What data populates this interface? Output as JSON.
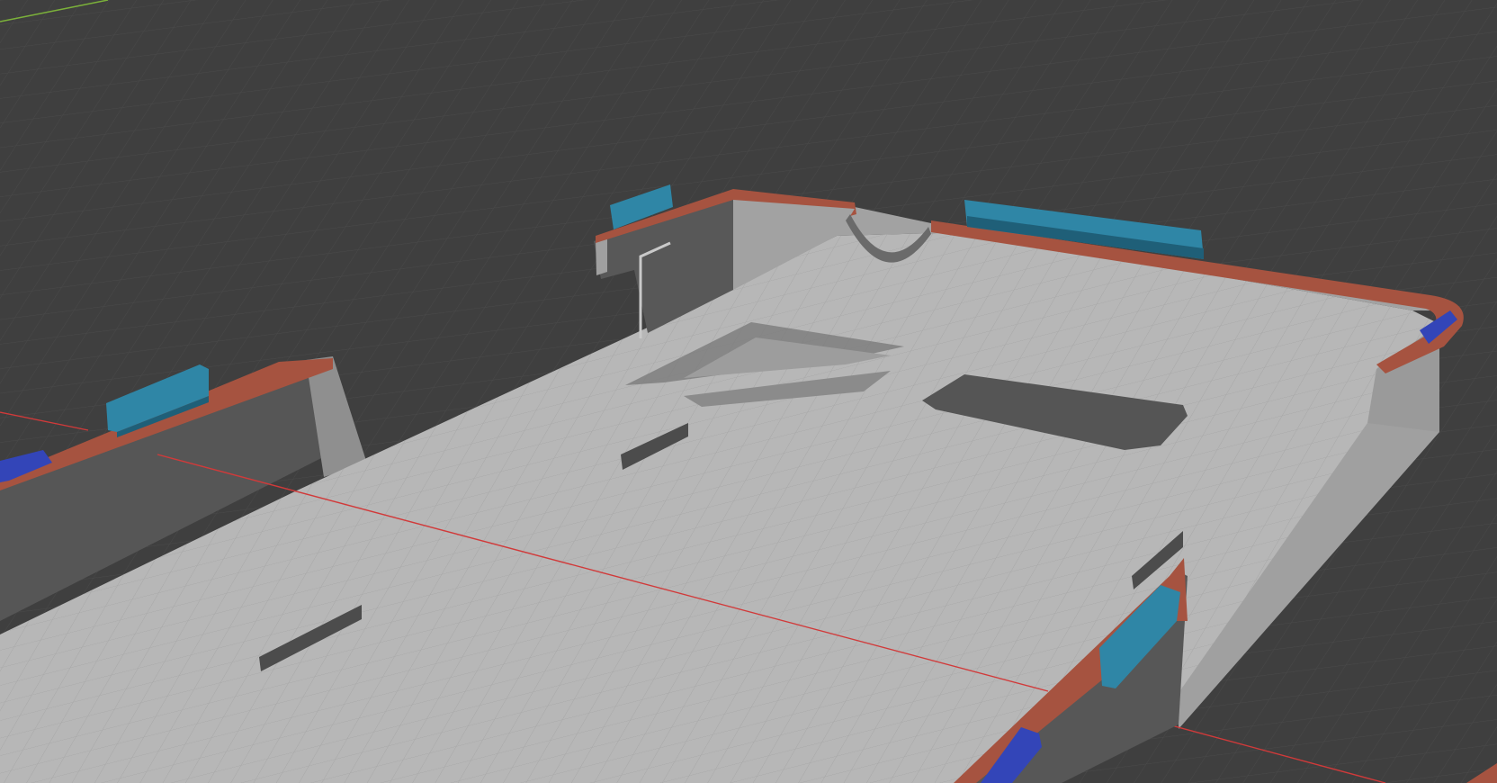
{
  "viewport": {
    "background_color": "#3f3f3f",
    "grid_line_color": "#4a4a4a",
    "x_axis_color": "#d13a3a",
    "y_axis_color": "#7bb13a"
  },
  "model": {
    "floor_color": "#b7b7b7",
    "floor_grid_color": "#a4a4a4",
    "wall_light_color": "#9a9a9a",
    "wall_dark_color": "#6e6e6e",
    "rim_color": "#a65340",
    "clip_color": "#2f86a6",
    "clip_dark_color": "#1f5f78",
    "button_color": "#3345b8",
    "hole_color": "#4c4c4c"
  },
  "icons": {
    "object": "phone-case-mesh",
    "floor_grid": "viewport-grid"
  }
}
